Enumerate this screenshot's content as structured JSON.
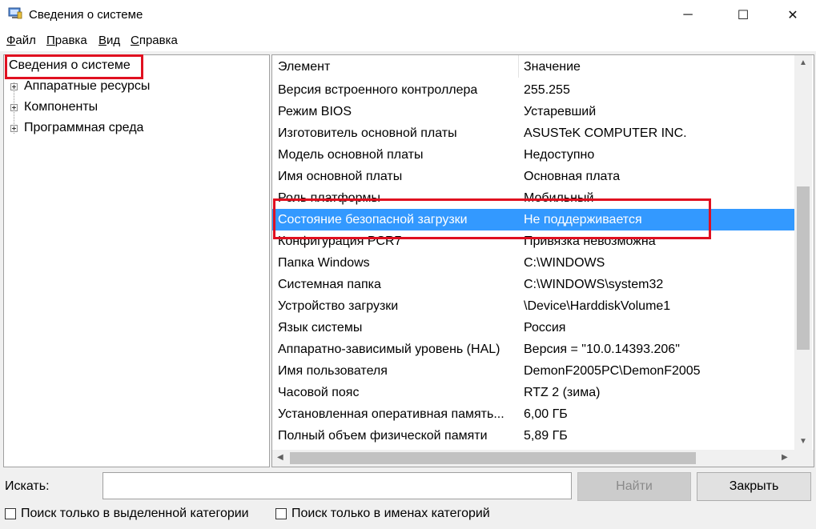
{
  "window": {
    "title": "Сведения о системе",
    "minimize_glyph": "─",
    "maximize_glyph": "☐",
    "close_glyph": "✕"
  },
  "menu": [
    {
      "accel": "Ф",
      "rest": "айл"
    },
    {
      "accel": "П",
      "rest": "равка"
    },
    {
      "accel": "В",
      "rest": "ид"
    },
    {
      "accel": "С",
      "rest": "правка"
    }
  ],
  "tree": {
    "root": "Сведения о системе",
    "items": [
      "Аппаратные ресурсы",
      "Компоненты",
      "Программная среда"
    ]
  },
  "table": {
    "headers": [
      "Элемент",
      "Значение"
    ],
    "rows": [
      [
        "Версия встроенного контроллера",
        "255.255"
      ],
      [
        "Режим BIOS",
        "Устаревший"
      ],
      [
        "Изготовитель основной платы",
        "ASUSTeK COMPUTER INC."
      ],
      [
        "Модель основной платы",
        "Недоступно"
      ],
      [
        "Имя основной платы",
        "Основная плата"
      ],
      [
        "Роль платформы",
        "Мобильный"
      ],
      [
        "Состояние безопасной загрузки",
        "Не поддерживается"
      ],
      [
        "Конфигурация PCR7",
        "Привязка невозможна"
      ],
      [
        "Папка Windows",
        "C:\\WINDOWS"
      ],
      [
        "Системная папка",
        "C:\\WINDOWS\\system32"
      ],
      [
        "Устройство загрузки",
        "\\Device\\HarddiskVolume1"
      ],
      [
        "Язык системы",
        "Россия"
      ],
      [
        "Аппаратно-зависимый уровень (HAL)",
        "Версия = \"10.0.14393.206\""
      ],
      [
        "Имя пользователя",
        "DemonF2005PC\\DemonF2005"
      ],
      [
        "Часовой пояс",
        "RTZ 2 (зима)"
      ],
      [
        "Установленная оперативная память...",
        "6,00 ГБ"
      ],
      [
        "Полный объем физической памяти",
        "5,89 ГБ"
      ]
    ],
    "selected_index": 6
  },
  "search": {
    "label": "Искать:",
    "value": "",
    "find_button": "Найти",
    "close_button": "Закрыть",
    "checkbox_selected_category": "Поиск только в выделенной категории",
    "checkbox_category_names": "Поиск только в именах категорий"
  },
  "colors": {
    "selection": "#3399ff",
    "highlight_box": "#e01020"
  },
  "icons": {
    "app": "system-info-icon",
    "expand": "plus-box-icon",
    "scroll_up": "arrow-up-icon",
    "scroll_down": "arrow-down-icon",
    "scroll_left": "arrow-left-icon",
    "scroll_right": "arrow-right-icon"
  }
}
